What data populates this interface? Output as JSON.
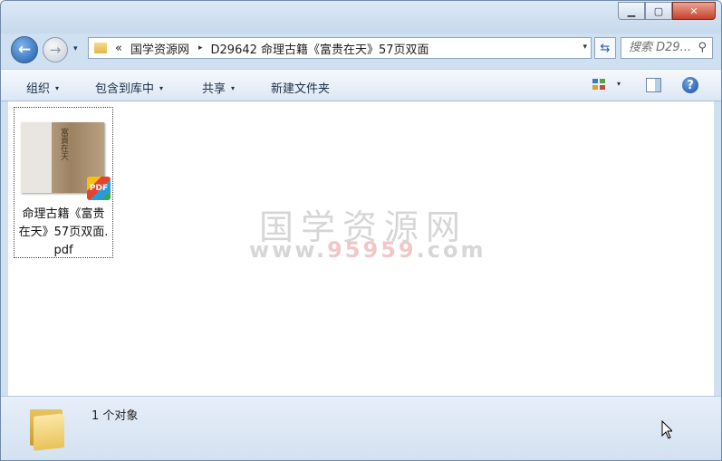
{
  "window": {
    "minimize_glyph": "▁",
    "maximize_glyph": "▢",
    "close_glyph": "✕"
  },
  "nav": {
    "back_glyph": "←",
    "forward_glyph": "→",
    "history_glyph": "▾",
    "refresh_glyph": "⇆",
    "address_overflow": "«",
    "breadcrumb": [
      "国学资源网",
      "D29642 命理古籍《富贵在天》57页双面"
    ],
    "breadcrumb_sep": "▸",
    "address_dropdown": "▾",
    "search_placeholder": "搜索 D29...",
    "search_icon": "⚲"
  },
  "toolbar": {
    "organize": "组织",
    "include_library": "包含到库中",
    "share": "共享",
    "new_folder": "新建文件夹",
    "dropdown_glyph": "▾",
    "help": "?"
  },
  "files": [
    {
      "name": "命理古籍《富贵在天》57页双面.pdf",
      "name_lines": [
        "命理古籍《富贵",
        "在天》57页双面.",
        "pdf"
      ],
      "badge": "PDF",
      "thumb_text": "富貴在天"
    }
  ],
  "watermark": {
    "line1": "国学资源网",
    "line2_prefix": "www.",
    "line2_number": "95959",
    "line2_suffix": ".com"
  },
  "status": {
    "count_text": "1 个对象"
  },
  "colors": {
    "accent": "#1d5aa8",
    "close_button": "#c8412a",
    "toolbar_bg": "#dce7f4"
  }
}
